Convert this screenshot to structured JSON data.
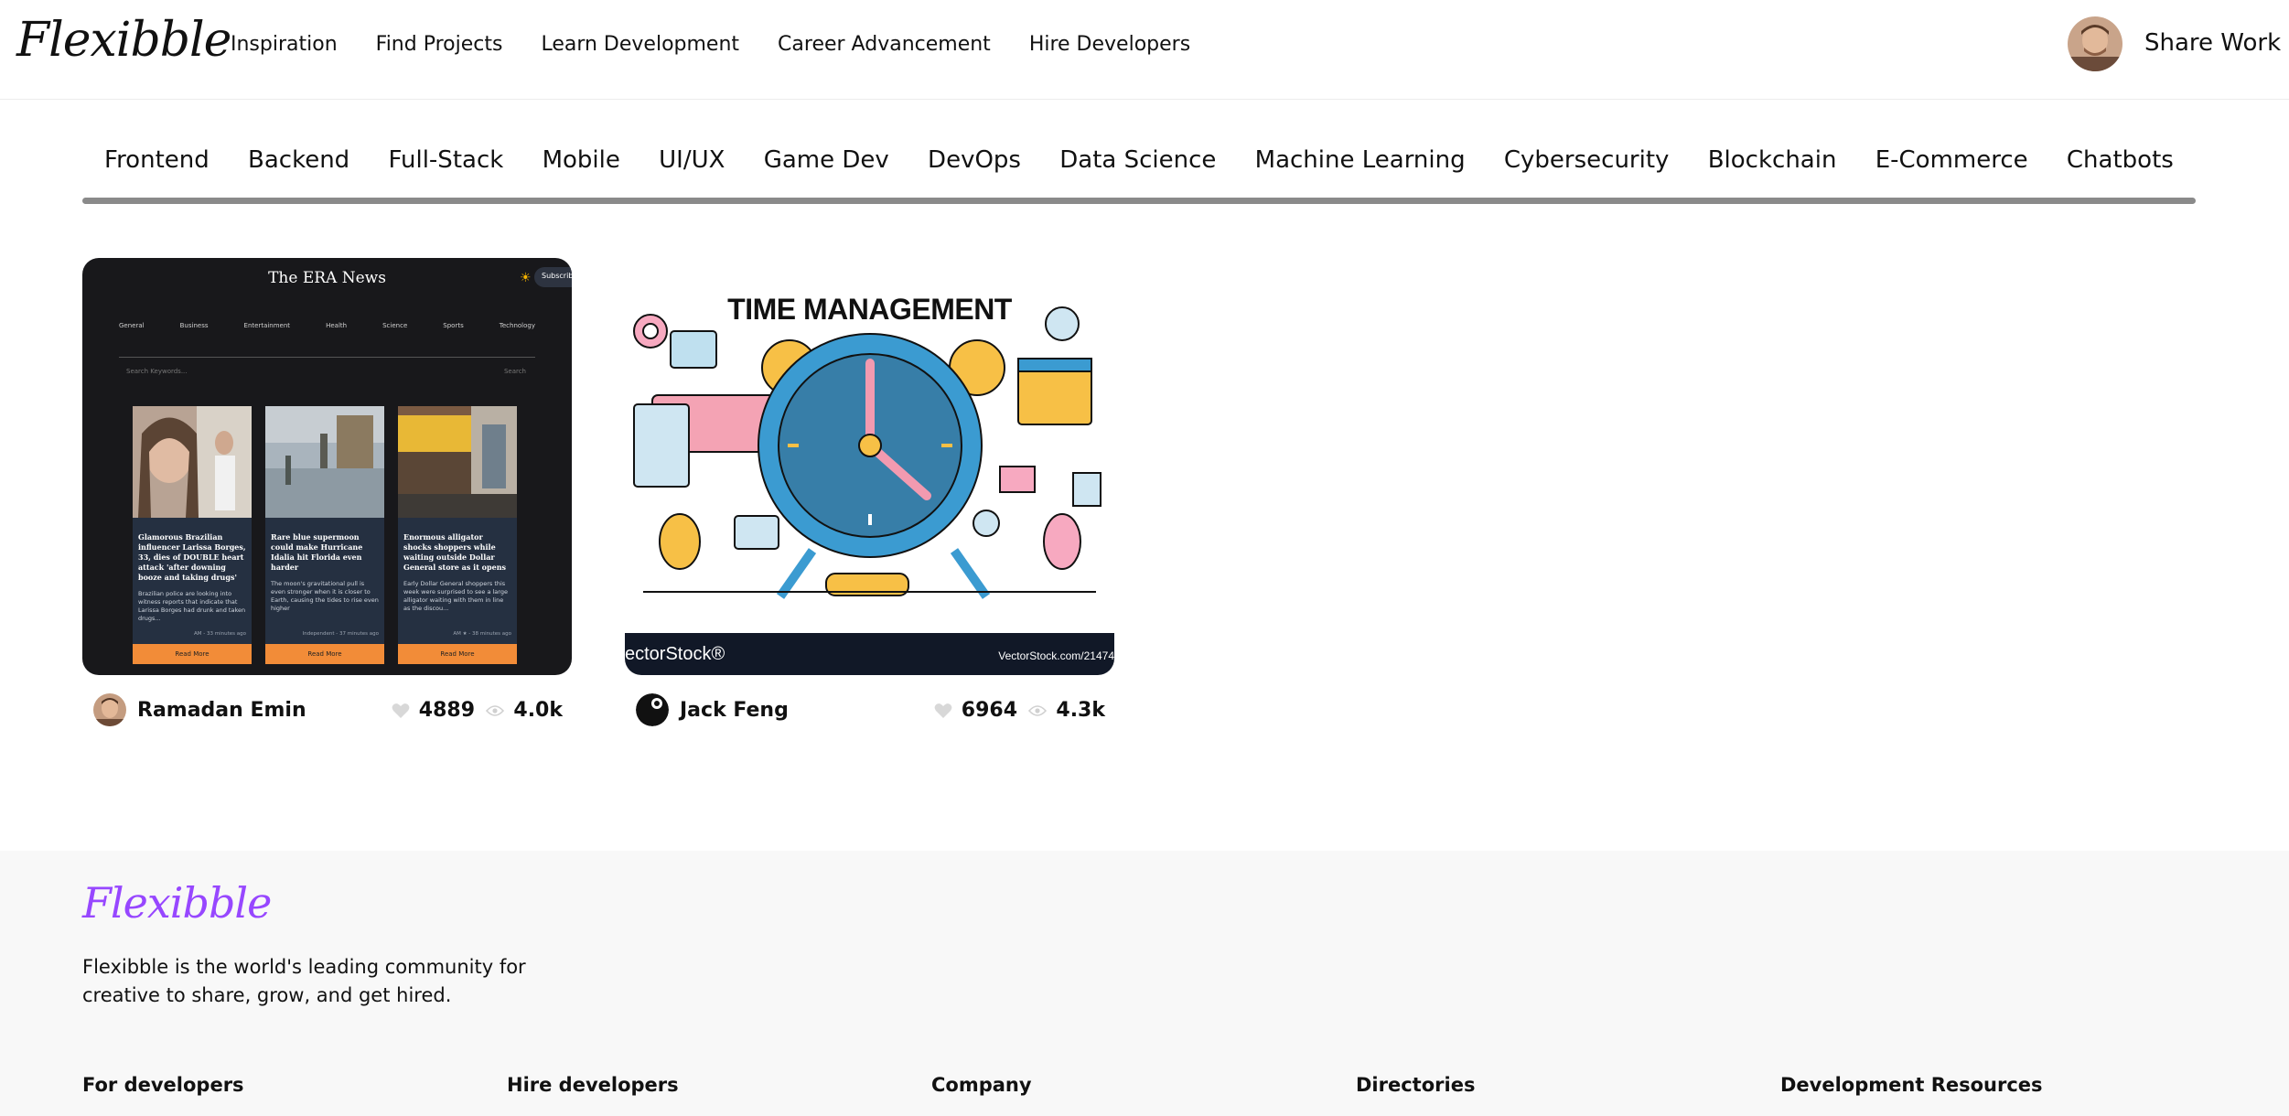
{
  "header": {
    "logo": "Flexibble",
    "nav": [
      "Inspiration",
      "Find Projects",
      "Learn Development",
      "Career Advancement",
      "Hire Developers"
    ],
    "share_work": "Share Work"
  },
  "categories": [
    "Frontend",
    "Backend",
    "Full-Stack",
    "Mobile",
    "UI/UX",
    "Game Dev",
    "DevOps",
    "Data Science",
    "Machine Learning",
    "Cybersecurity",
    "Blockchain",
    "E-Commerce",
    "Chatbots"
  ],
  "projects": [
    {
      "author": "Ramadan Emin",
      "likes": "4889",
      "views": "4.0k",
      "preview": {
        "title": "The ERA News",
        "subscribe": "Subscribe",
        "categories": [
          "General",
          "Business",
          "Entertainment",
          "Health",
          "Science",
          "Sports",
          "Technology"
        ],
        "search_placeholder": "Search Keywords...",
        "search_button": "Search",
        "articles": [
          {
            "title": "Glamorous Brazilian influencer Larissa Borges, 33, dies of DOUBLE heart attack 'after downing booze and taking drugs'",
            "desc": "Brazilian police are looking into witness reports that indicate that Larissa Borges had drunk and taken drugs...",
            "source": "AM - 33 minutes ago",
            "button": "Read More"
          },
          {
            "title": "Rare blue supermoon could make Hurricane Idalia hit Florida even harder",
            "desc": "The moon's gravitational pull is even stronger when it is closer to Earth, causing the tides to rise even higher",
            "source": "Independent - 37 minutes ago",
            "button": "Read More"
          },
          {
            "title": "Enormous alligator shocks shoppers while waiting outside Dollar General store as it opens",
            "desc": "Early Dollar General shoppers this week were surprised to see a large alligator waiting with them in line as the discou...",
            "source": "AM ★ - 38 minutes ago",
            "button": "Read More"
          }
        ]
      }
    },
    {
      "author": "Jack Feng",
      "likes": "6964",
      "views": "4.3k",
      "preview": {
        "title": "TIME MANAGEMENT",
        "brand": "ectorStock®",
        "url": "VectorStock.com/21474"
      }
    }
  ],
  "footer": {
    "logo": "Flexibble",
    "tagline": "Flexibble is the world's leading community for creative to share, grow, and get hired.",
    "columns": [
      "For developers",
      "Hire developers",
      "Company",
      "Directories",
      "Development Resources"
    ]
  },
  "colors": {
    "accent": "#9747ff",
    "category_underline": "#8a8a8a",
    "news_bg": "#18181b",
    "read_more": "#f28c38"
  }
}
